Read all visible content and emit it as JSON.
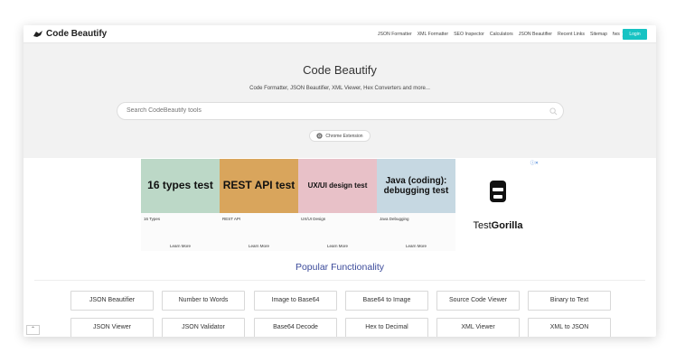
{
  "brand": {
    "name": "Code Beautify"
  },
  "nav": {
    "items": [
      "JSON Formatter",
      "XML Formatter",
      "SEO Inspector",
      "Calculators",
      "JSON Beautifier",
      "Recent Links",
      "Sitemap",
      "fws"
    ],
    "login": "Login"
  },
  "hero": {
    "title": "Code Beautify",
    "subtitle": "Code Formatter, JSON Beautifier, XML Viewer, Hex Converters and more...",
    "search_placeholder": "Search CodeBeautify tools",
    "chrome_extension": "Chrome Extension"
  },
  "ad": {
    "tiles": [
      {
        "headline": "16 types test",
        "caption": "16 Types",
        "cta": "Learn More",
        "bg": "#bcd8c7"
      },
      {
        "headline": "REST API test",
        "caption": "REST API",
        "cta": "Learn More",
        "bg": "#d9a55c"
      },
      {
        "headline": "UX/UI design test",
        "caption": "UX/UI Design",
        "cta": "Learn More",
        "bg": "#e8c1c8"
      },
      {
        "headline": "Java (coding): debugging test",
        "caption": "Java Debugging",
        "cta": "Learn More",
        "bg": "#c6d8e2"
      }
    ],
    "sponsor_prefix": "Test",
    "sponsor_bold": "Gorilla"
  },
  "section": {
    "title": "Popular Functionality"
  },
  "tools": {
    "row1": [
      "JSON Beautifier",
      "Number to Words",
      "Image to Base64",
      "Base64 to Image",
      "Source Code Viewer",
      "Binary to Text"
    ],
    "row2": [
      "JSON Viewer",
      "JSON Validator",
      "Base64 Decode",
      "Hex to Decimal",
      "XML Viewer",
      "XML to JSON"
    ]
  },
  "colors": {
    "accent": "#17c3c3",
    "section_title": "#3b4a9a",
    "hero_bg": "#f2f2f2"
  }
}
